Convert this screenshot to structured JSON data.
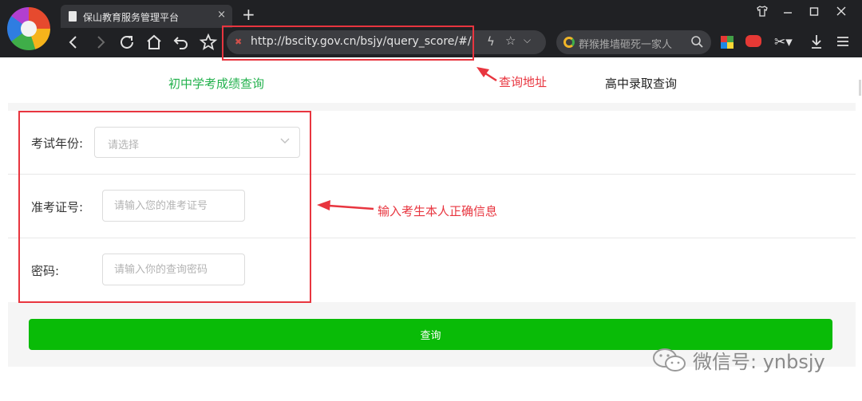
{
  "browser": {
    "tab_title": "保山教育服务管理平台",
    "tab_close": "×",
    "new_tab": "+",
    "address": "http://bscity.gov.cn/bsjy/query_score/#/",
    "search_placeholder": "群猴推墙砸死一家人",
    "icons": [
      "browser-logo-icon",
      "back-icon",
      "forward-icon",
      "reload-icon",
      "home-icon",
      "undo-icon",
      "bookmark-star-icon",
      "lightning-icon",
      "favorite-star-icon",
      "search-icon",
      "apps-icon",
      "game-icon",
      "scissors-icon",
      "download-icon",
      "menu-icon"
    ]
  },
  "page": {
    "tabs": [
      {
        "label": "初中学考成绩查询",
        "active": true
      },
      {
        "label": "高中录取查询",
        "active": false
      }
    ],
    "form": {
      "year_label": "考试年份:",
      "year_placeholder": "请选择",
      "ticket_label": "准考证号:",
      "ticket_placeholder": "请输入您的准考证号",
      "password_label": "密码:",
      "password_placeholder": "请输入你的查询密码"
    },
    "submit_label": "查询",
    "accent_color": "#09bb07"
  },
  "annotations": {
    "address_note": "查询地址",
    "form_note": "输入考生本人正确信息",
    "color": "#e8353f"
  },
  "watermark": {
    "text": "微信号: ynbsjy"
  }
}
